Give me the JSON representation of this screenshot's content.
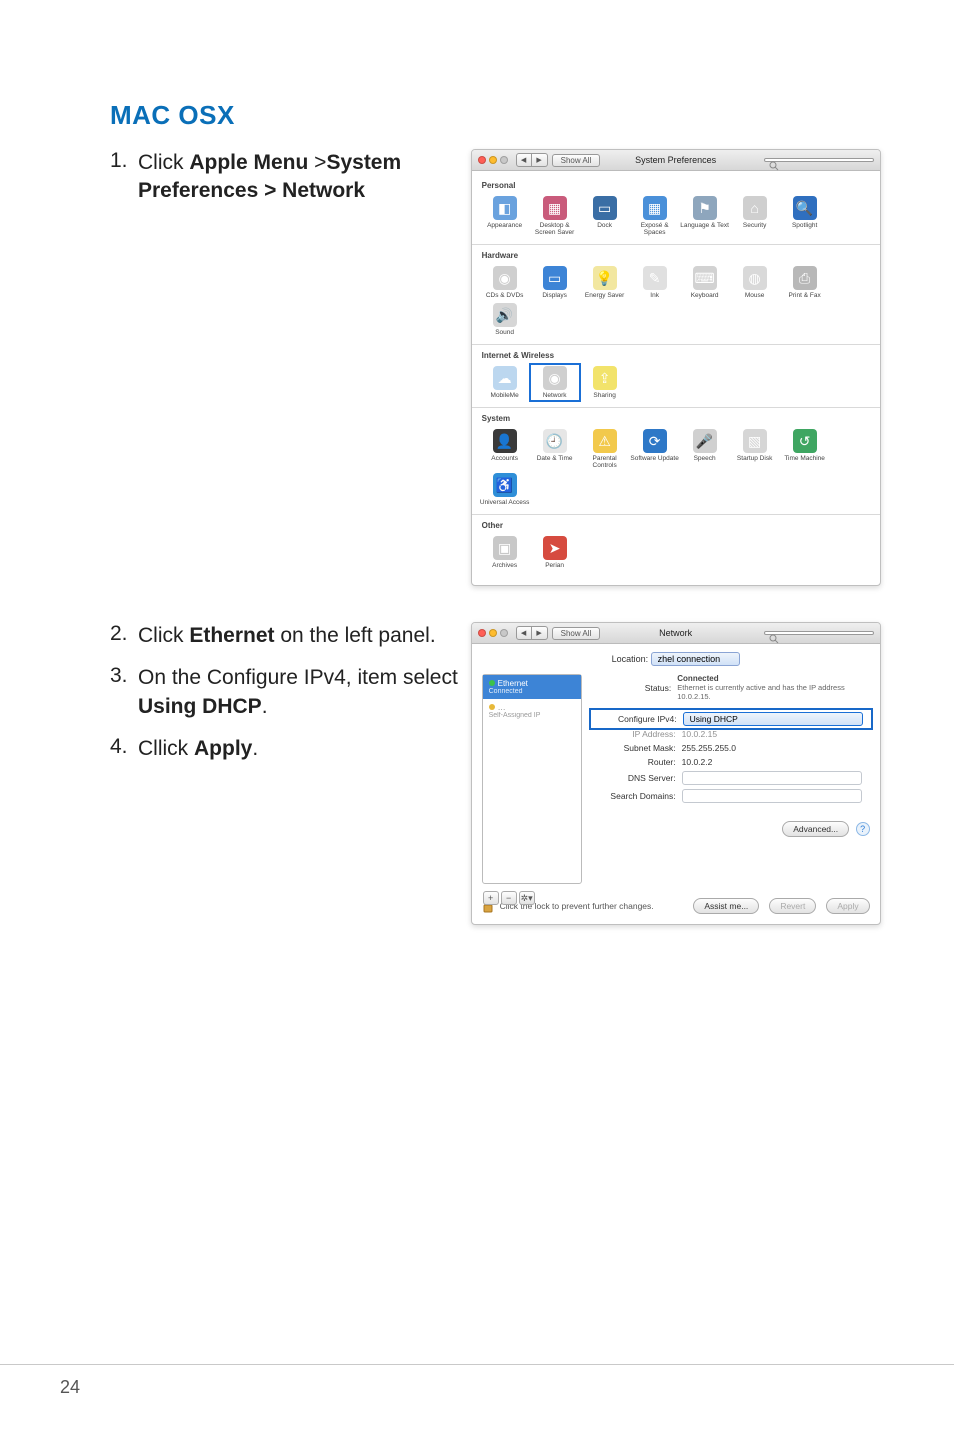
{
  "page_number": "24",
  "heading": "MAC OSX",
  "steps": [
    {
      "num": "1.",
      "pre": "Click ",
      "b1": "Apple Menu",
      "mid": " >",
      "b2": "System Preferences > Network"
    },
    {
      "num": "2.",
      "pre": "Click ",
      "b1": "Ethernet",
      "post": " on the left panel."
    },
    {
      "num": "3.",
      "pre": "On the Configure IPv4, item select ",
      "b1": "Using DHCP",
      "post": "."
    },
    {
      "num": "4.",
      "pre": "Cllick ",
      "b1": "Apply",
      "post": "."
    }
  ],
  "sysprefs": {
    "title": "System Preferences",
    "show_all": "Show All",
    "search_placeholder": "",
    "sections": [
      {
        "label": "Personal",
        "items": [
          {
            "name": "Appearance",
            "bg": "#6aa2de",
            "g": "◧"
          },
          {
            "name": "Desktop & Screen Saver",
            "bg": "#c95b7b",
            "g": "▦"
          },
          {
            "name": "Dock",
            "bg": "#3a6ea5",
            "g": "▭"
          },
          {
            "name": "Exposé & Spaces",
            "bg": "#4a90d9",
            "g": "▦"
          },
          {
            "name": "Language & Text",
            "bg": "#8ea6bd",
            "g": "⚑"
          },
          {
            "name": "Security",
            "bg": "#cfcfcf",
            "g": "⌂"
          },
          {
            "name": "Spotlight",
            "bg": "#2f6fbf",
            "g": "🔍"
          }
        ]
      },
      {
        "label": "Hardware",
        "items": [
          {
            "name": "CDs & DVDs",
            "bg": "#cfcfcf",
            "g": "◉"
          },
          {
            "name": "Displays",
            "bg": "#3d84d6",
            "g": "▭"
          },
          {
            "name": "Energy Saver",
            "bg": "#f2e7a0",
            "g": "💡"
          },
          {
            "name": "Ink",
            "bg": "#e0e0e0",
            "g": "✎"
          },
          {
            "name": "Keyboard",
            "bg": "#d2d2d2",
            "g": "⌨"
          },
          {
            "name": "Mouse",
            "bg": "#d9d9d9",
            "g": "◍"
          },
          {
            "name": "Print & Fax",
            "bg": "#b8b8b8",
            "g": "⎙"
          },
          {
            "name": "Sound",
            "bg": "#d6d6d6",
            "g": "🔊"
          }
        ]
      },
      {
        "label": "Internet & Wireless",
        "items": [
          {
            "name": "MobileMe",
            "bg": "#bcd7ef",
            "g": "☁"
          },
          {
            "name": "Network",
            "bg": "#cfcfcf",
            "g": "◉",
            "cls": "network"
          },
          {
            "name": "Sharing",
            "bg": "#f2e36b",
            "g": "⇪"
          }
        ]
      },
      {
        "label": "System",
        "items": [
          {
            "name": "Accounts",
            "bg": "#3a3a3a",
            "g": "👤"
          },
          {
            "name": "Date & Time",
            "bg": "#e6e6e6",
            "g": "🕘"
          },
          {
            "name": "Parental Controls",
            "bg": "#f2c94c",
            "g": "⚠"
          },
          {
            "name": "Software Update",
            "bg": "#2e78c7",
            "g": "⟳"
          },
          {
            "name": "Speech",
            "bg": "#d0d0d0",
            "g": "🎤"
          },
          {
            "name": "Startup Disk",
            "bg": "#d6d6d6",
            "g": "▧"
          },
          {
            "name": "Time Machine",
            "bg": "#3fa662",
            "g": "↺"
          },
          {
            "name": "Universal Access",
            "bg": "#2f8fd8",
            "g": "♿"
          }
        ]
      },
      {
        "label": "Other",
        "items": [
          {
            "name": "Archives",
            "bg": "#c8c8c8",
            "g": "▣"
          },
          {
            "name": "Perian",
            "bg": "#d64b3f",
            "g": "➤"
          }
        ]
      }
    ]
  },
  "network": {
    "title": "Network",
    "show_all": "Show All",
    "location_label": "Location:",
    "location_value": "zhel connection",
    "sidebar": [
      {
        "name": "Ethernet",
        "sub": "Connected",
        "sel": true
      },
      {
        "name": "…",
        "sub": "Self-Assigned IP",
        "dim": true
      }
    ],
    "status_label": "Status:",
    "status_value": "Connected",
    "status_sub": "Ethernet is currently active and has the IP address 10.0.2.15.",
    "configure_label": "Configure IPv4:",
    "configure_value": "Using DHCP",
    "ip_label": "IP Address:",
    "ip_value": "10.0.2.15",
    "mask_label": "Subnet Mask:",
    "mask_value": "255.255.255.0",
    "router_label": "Router:",
    "router_value": "10.0.2.2",
    "dns_label": "DNS Server:",
    "search_label": "Search Domains:",
    "advanced": "Advanced...",
    "lock_text": "Click the lock to prevent further changes.",
    "assist": "Assist me...",
    "revert": "Revert",
    "apply": "Apply"
  }
}
